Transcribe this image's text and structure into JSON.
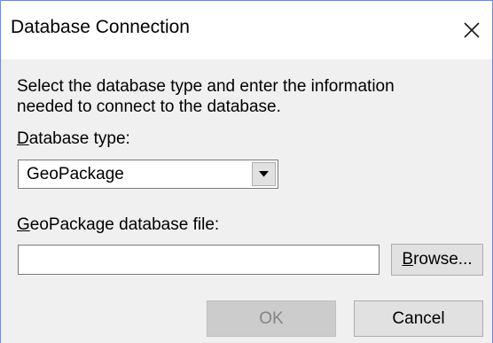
{
  "window": {
    "title": "Database Connection",
    "close_icon": "close-icon"
  },
  "description": {
    "line1": "Select the database type and enter the information",
    "line2": "needed to connect to the database."
  },
  "database_type": {
    "label_mnemonic": "D",
    "label_rest": "atabase type:",
    "selected": "GeoPackage",
    "dropdown_icon": "chevron-down-icon"
  },
  "file": {
    "label_mnemonic": "G",
    "label_rest": "eoPackage database file:",
    "value": "",
    "placeholder": ""
  },
  "buttons": {
    "browse_mnemonic": "B",
    "browse_rest": "rowse...",
    "ok": "OK",
    "ok_enabled": false,
    "cancel": "Cancel"
  },
  "colors": {
    "window_border": "#6d8fc7",
    "dialog_background": "#f0f0f0",
    "titlebar_background": "#ffffff",
    "button_face": "#e1e1e1",
    "disabled_text": "#838383"
  }
}
